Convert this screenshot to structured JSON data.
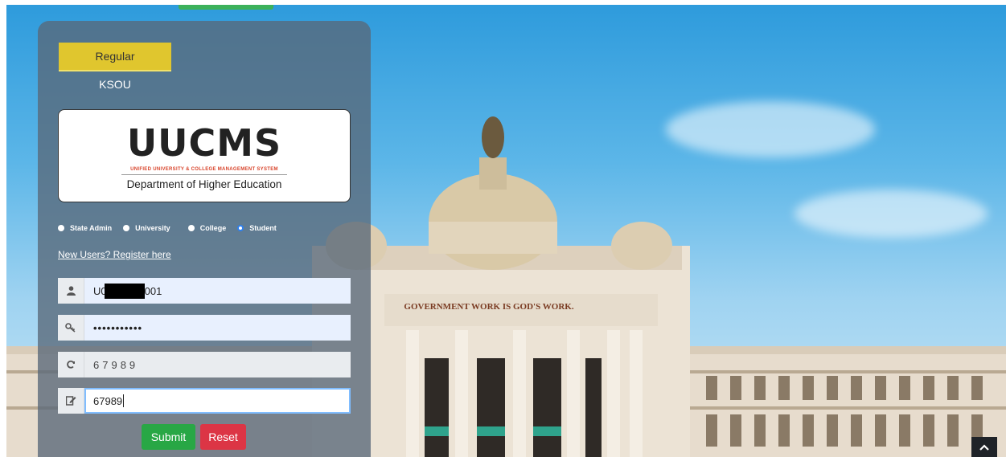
{
  "tabs": {
    "regular": "Regular",
    "ksou": "KSOU"
  },
  "logo": {
    "name": "UUCMS",
    "tagline": "UNIFIED UNIVERSITY & COLLEGE MANAGEMENT SYSTEM",
    "department": "Department of Higher Education"
  },
  "roles": [
    {
      "label": "State Admin",
      "selected": false
    },
    {
      "label": "University",
      "selected": false
    },
    {
      "label": "College",
      "selected": false
    },
    {
      "label": "Student",
      "selected": true
    }
  ],
  "register_link": "New Users? Register here",
  "form": {
    "username_prefix": "U0",
    "username_suffix": "001",
    "password": "•••••••••••",
    "captcha": "67989",
    "captcha_input": "67989"
  },
  "buttons": {
    "submit": "Submit",
    "reset": "Reset"
  },
  "icons": {
    "user": "user-icon",
    "key": "key-icon",
    "refresh": "refresh-icon",
    "edit": "edit-icon",
    "scroll_top": "chevron-up-icon"
  },
  "building_sign": "GOVERNMENT WORK IS GOD'S WORK.",
  "colors": {
    "tab_active": "#e0c62e",
    "submit": "#28a745",
    "reset": "#dc3545",
    "panel": "#586878"
  }
}
